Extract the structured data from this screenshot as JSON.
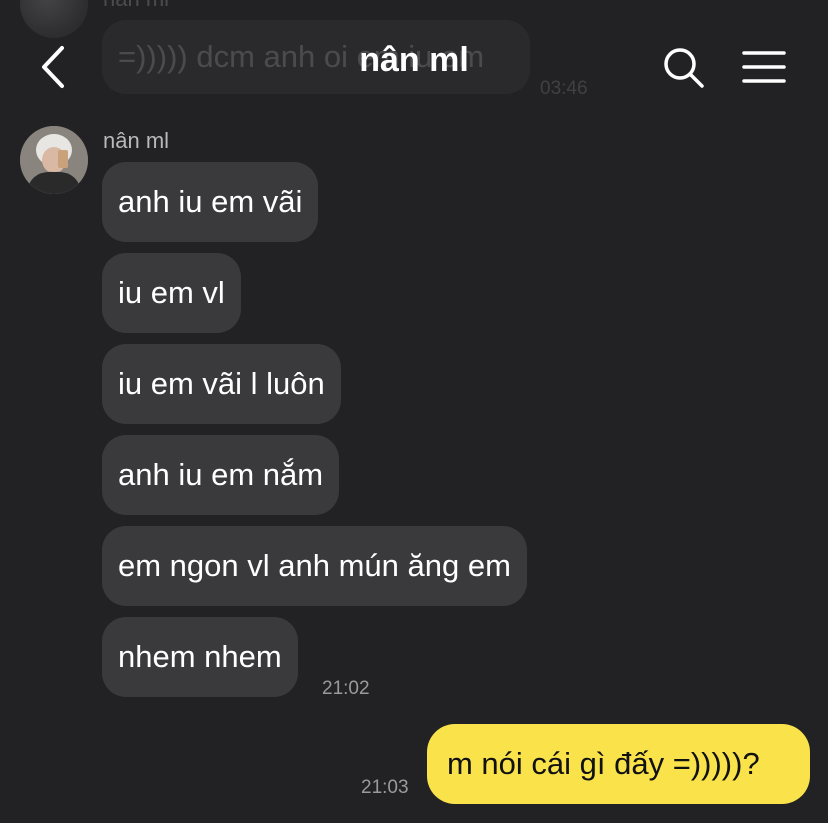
{
  "header": {
    "title": "nân ml"
  },
  "ghost": {
    "sender": "nân ml",
    "text": "=))))) dcm anh oi em iu em",
    "time": "03:46"
  },
  "conversation": {
    "sender": "nân ml",
    "messages": [
      "anh iu em vãi",
      "iu em vl",
      "iu em vãi l luôn",
      "anh iu em nắm",
      "em ngon vl anh mún ăng em",
      "nhem nhem"
    ],
    "incoming_time": "21:02",
    "outgoing": {
      "text": "m nói cái gì đấy =)))))?",
      "time": "21:03"
    }
  },
  "colors": {
    "background": "#222224",
    "incoming_bubble": "#3a3a3c",
    "outgoing_bubble": "#fae34a"
  },
  "icons": [
    "back-icon",
    "search-icon",
    "menu-icon"
  ]
}
